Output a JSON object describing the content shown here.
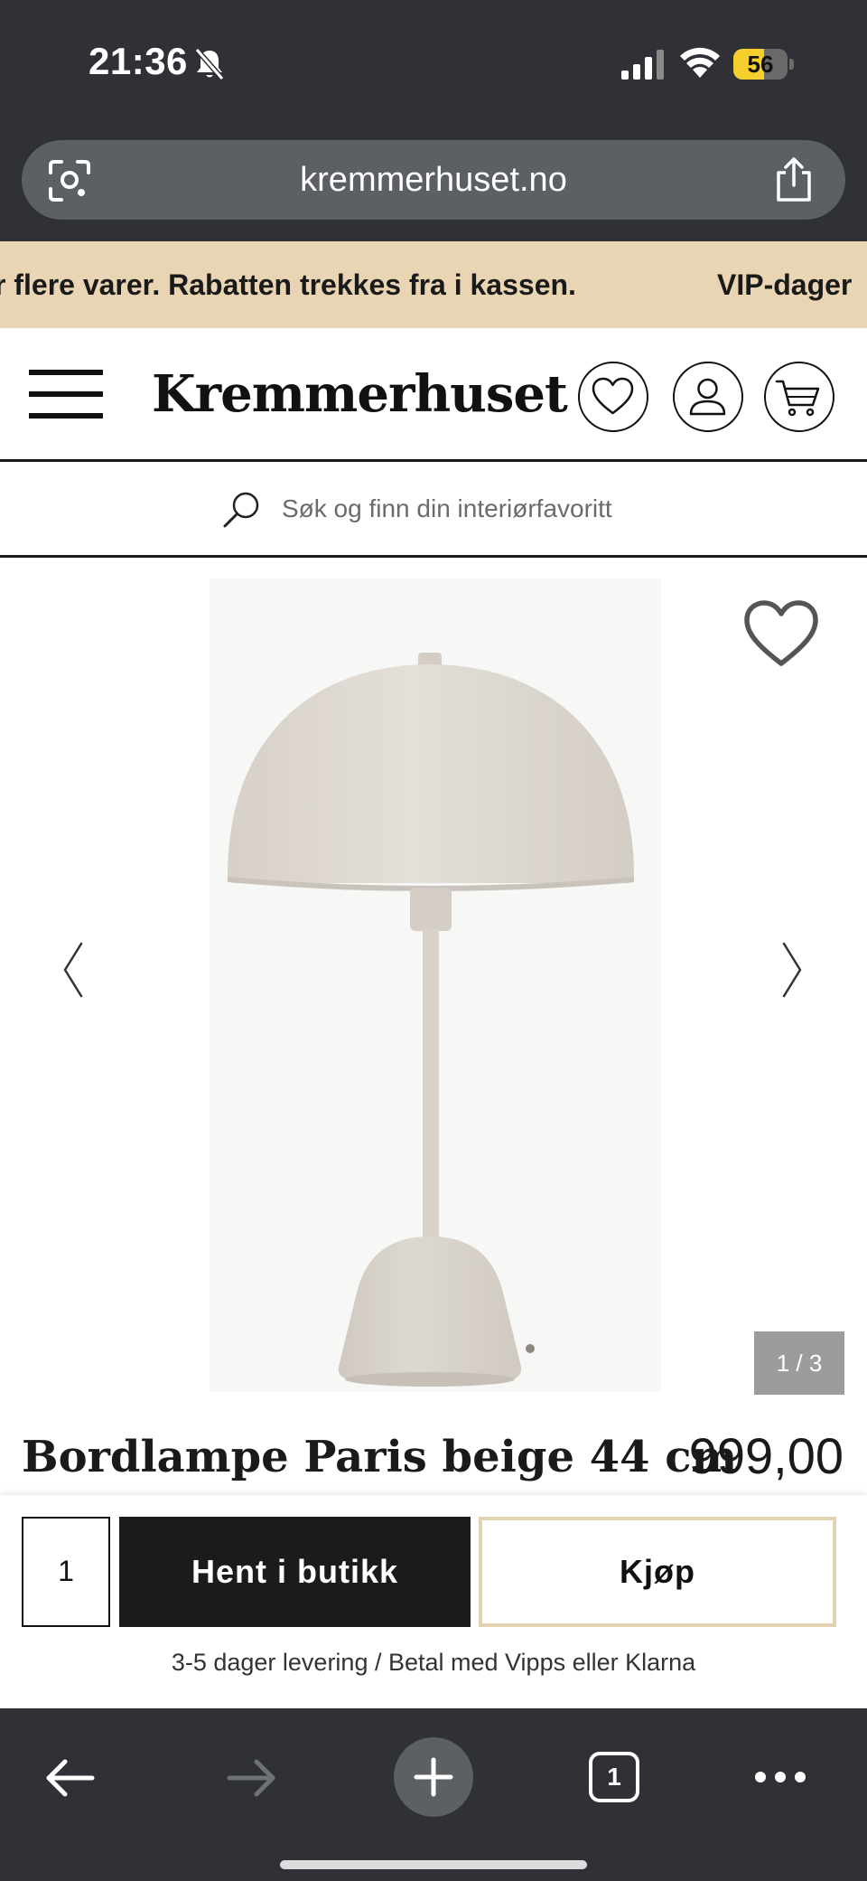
{
  "status_bar": {
    "time": "21:36",
    "battery_level": "56",
    "battery_fraction": 0.56
  },
  "browser": {
    "url": "kremmerhuset.no",
    "tab_count": "1"
  },
  "promo": {
    "text": "r flere varer. Rabatten trekkes fra i kassen.",
    "text_next": "VIP-dager"
  },
  "header": {
    "logo": "Kremmerhuset"
  },
  "search": {
    "placeholder": "Søk og finn din interiørfavoritt"
  },
  "gallery": {
    "counter": "1 / 3"
  },
  "product": {
    "title": "Bordlampe Paris beige 44 cm",
    "price": "999,00"
  },
  "buy_bar": {
    "quantity": "1",
    "pickup_label": "Hent i butikk",
    "buy_label": "Kjøp",
    "delivery_text": "3-5 dager levering / Betal med Vipps eller Klarna"
  },
  "icons": {
    "bell": "bell-slash-icon",
    "signal": "cellular-signal-icon",
    "wifi": "wifi-icon",
    "lens": "camera-lens-icon",
    "share": "share-icon",
    "menu": "hamburger-menu-icon",
    "wishlist": "heart-icon",
    "account": "user-icon",
    "cart": "cart-icon",
    "search": "search-icon",
    "prev": "chevron-left-icon",
    "next": "chevron-right-icon",
    "back": "arrow-left-icon",
    "forward": "arrow-right-icon",
    "new_tab": "plus-icon",
    "more": "ellipsis-icon"
  },
  "colors": {
    "promo_background": "#e9d5b3",
    "buy_border": "#e3d2b0",
    "pickup_background": "#1b1b1b",
    "browser_chrome": "#2f3136",
    "battery_fill": "#f5cf2c"
  }
}
